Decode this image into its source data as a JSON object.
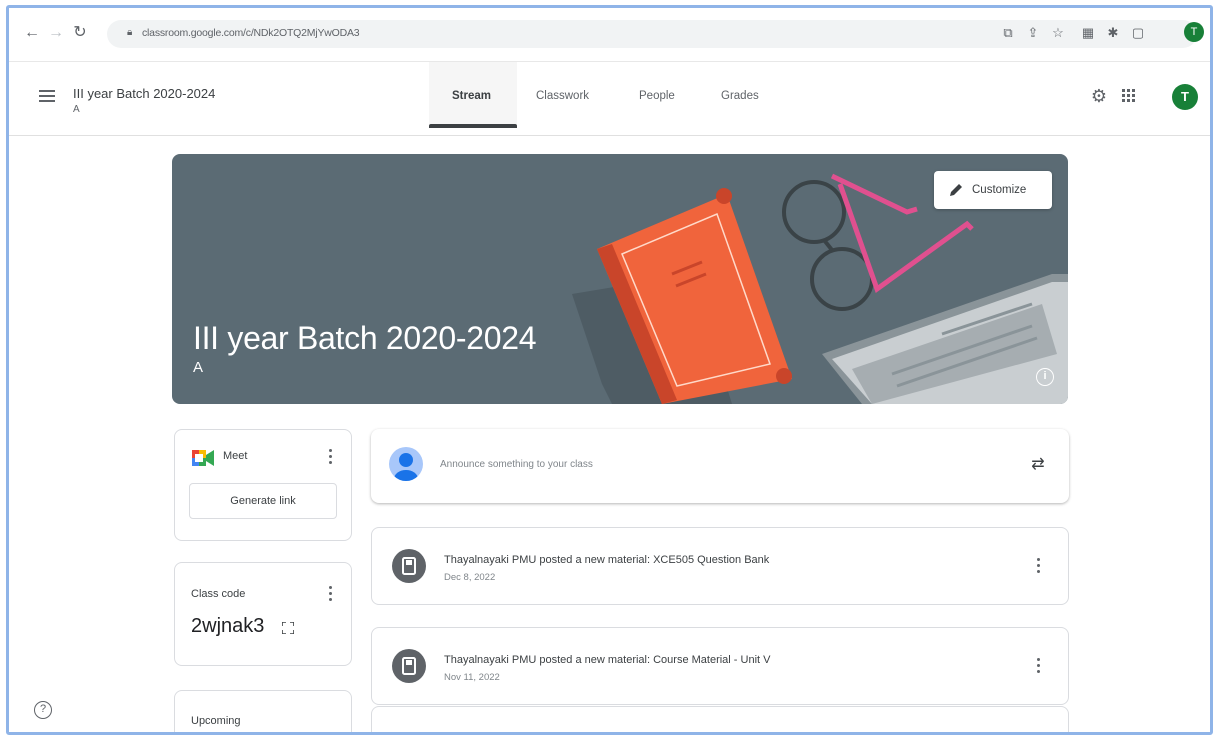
{
  "browser": {
    "url": "classroom.google.com/c/NDk2OTQ2MjYwODA3",
    "profile_initial": "T"
  },
  "header": {
    "course_title": "III year Batch 2020-2024",
    "course_section": "A",
    "tabs": [
      {
        "label": "Stream",
        "active": true
      },
      {
        "label": "Classwork",
        "active": false
      },
      {
        "label": "People",
        "active": false
      },
      {
        "label": "Grades",
        "active": false
      }
    ],
    "avatar_initial": "T"
  },
  "banner": {
    "title": "III year Batch 2020-2024",
    "section": "A",
    "customize_label": "Customize"
  },
  "meet": {
    "label": "Meet",
    "generate_link_label": "Generate link"
  },
  "class_code": {
    "label": "Class code",
    "value": "2wjnak3"
  },
  "upcoming": {
    "label": "Upcoming"
  },
  "stream": {
    "announce_placeholder": "Announce something to your class",
    "posts": [
      {
        "title": "Thayalnayaki PMU posted a new material: XCE505 Question Bank",
        "date": "Dec 8, 2022"
      },
      {
        "title": "Thayalnayaki PMU posted a new material: Course Material - Unit V",
        "date": "Nov 11, 2022"
      }
    ]
  },
  "colors": {
    "banner_bg": "#5b6b74",
    "book": "#f0643c",
    "glasses_pink": "#e0508f",
    "avatar_green": "#188038"
  }
}
